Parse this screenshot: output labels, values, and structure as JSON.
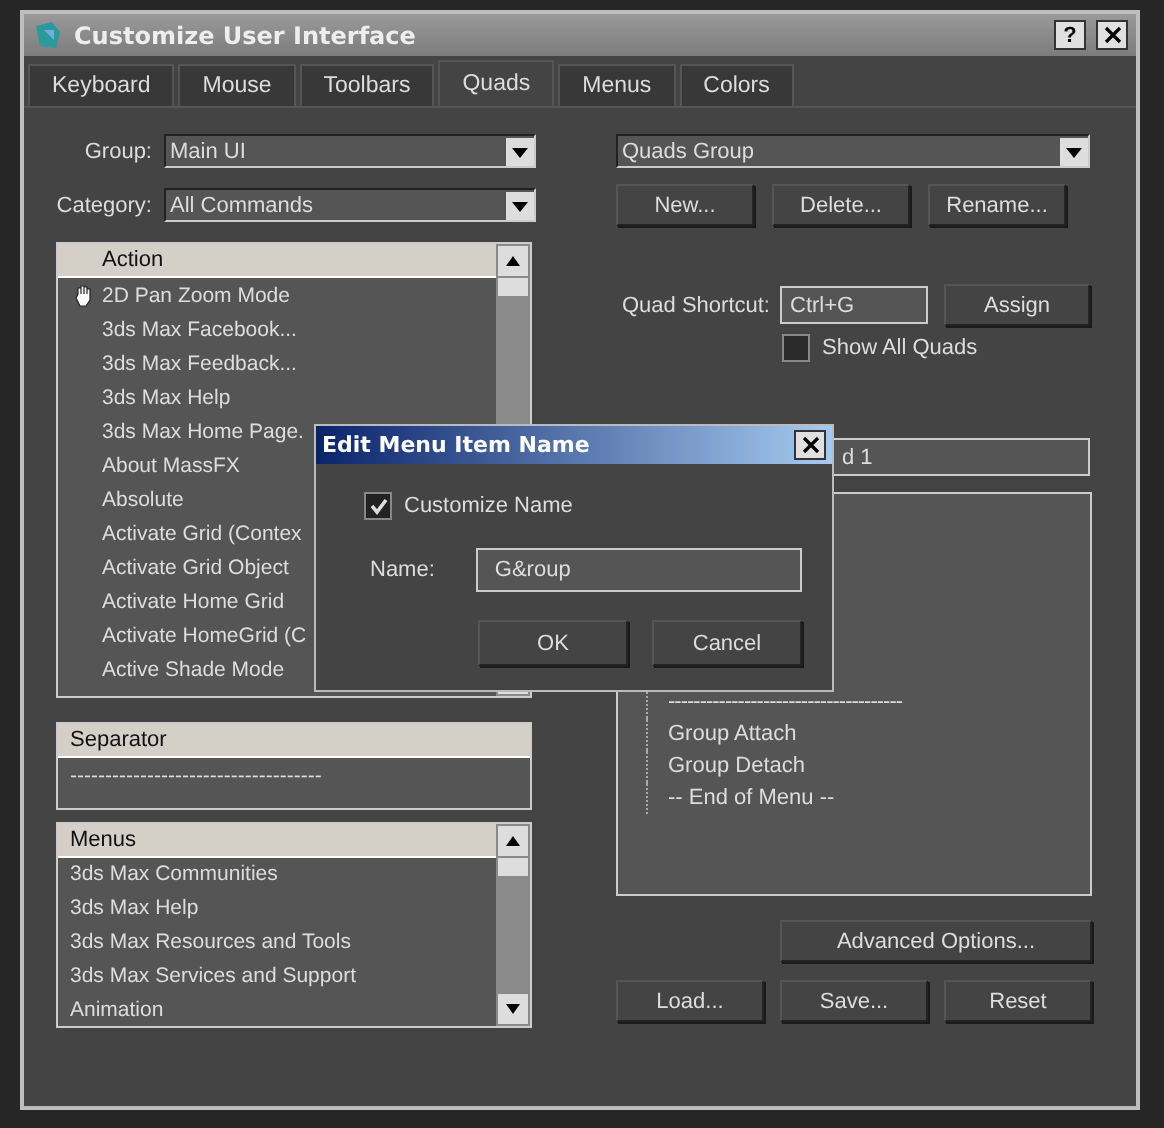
{
  "window": {
    "title": "Customize User Interface",
    "help_button": "?"
  },
  "tabs": [
    {
      "label": "Keyboard",
      "selected": false
    },
    {
      "label": "Mouse",
      "selected": false
    },
    {
      "label": "Toolbars",
      "selected": false
    },
    {
      "label": "Quads",
      "selected": true
    },
    {
      "label": "Menus",
      "selected": false
    },
    {
      "label": "Colors",
      "selected": false
    }
  ],
  "group": {
    "label": "Group:",
    "value": "Main UI"
  },
  "category": {
    "label": "Category:",
    "value": "All Commands"
  },
  "action_list": {
    "header": "Action",
    "items": [
      {
        "label": "2D Pan Zoom Mode",
        "kind": "hand"
      },
      {
        "label": "3ds Max Facebook...",
        "kind": "plain"
      },
      {
        "label": "3ds Max Feedback...",
        "kind": "plain"
      },
      {
        "label": "3ds Max Help",
        "kind": "plain"
      },
      {
        "label": "3ds Max Home Page.",
        "kind": "plain"
      },
      {
        "label": "About MassFX",
        "kind": "plain"
      },
      {
        "label": "Absolute",
        "kind": "plain"
      },
      {
        "label": "Activate Grid (Contex",
        "kind": "plain"
      },
      {
        "label": "Activate Grid Object",
        "kind": "plain"
      },
      {
        "label": "Activate Home Grid",
        "kind": "plain"
      },
      {
        "label": "Activate HomeGrid (C",
        "kind": "plain"
      },
      {
        "label": "Active Shade Mode",
        "kind": "plain"
      }
    ]
  },
  "separator_list": {
    "header": "Separator",
    "items": [
      "------------------------------------"
    ]
  },
  "menus_list": {
    "header": "Menus",
    "items": [
      "3ds Max Communities",
      "3ds Max Help",
      "3ds Max Resources and Tools",
      "3ds Max Services and Support",
      "Animation"
    ]
  },
  "quad_set": {
    "value": "Quads Group"
  },
  "set_buttons": [
    "New...",
    "Delete...",
    "Rename..."
  ],
  "shortcut": {
    "label": "Quad Shortcut:",
    "value": "Ctrl+G",
    "button": "Assign"
  },
  "show_all_quads": {
    "label": "Show All Quads",
    "checked": false
  },
  "quad_name": {
    "value": "d 1"
  },
  "tree": [
    {
      "label": "-------------------------------------",
      "kind": "separator"
    },
    {
      "label": "Group Attach",
      "kind": "item"
    },
    {
      "label": "Group Detach",
      "kind": "item"
    },
    {
      "label": "-- End of Menu --",
      "kind": "item"
    }
  ],
  "advanced_button": "Advanced Options...",
  "bottom_buttons": [
    "Load...",
    "Save...",
    "Reset"
  ],
  "dialog": {
    "title": "Edit Menu Item Name",
    "customize": {
      "label": "Customize Name",
      "checked": true
    },
    "name_label": "Name:",
    "name_value": "G&roup",
    "buttons": [
      "OK",
      "Cancel"
    ]
  }
}
